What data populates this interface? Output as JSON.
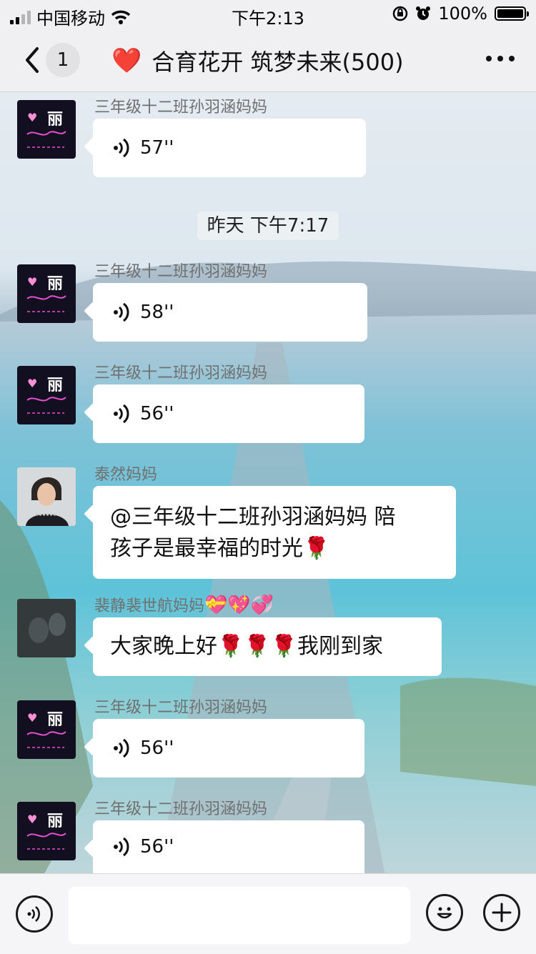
{
  "status_bar": {
    "carrier": "中国移动",
    "time": "下午2:13",
    "battery": "100%",
    "battery_level": 1.0
  },
  "nav": {
    "unread_count": "1",
    "title_emoji": "❤️",
    "title": "合育花开 筑梦未来(500)",
    "more_icon": "more-dots-icon"
  },
  "timestamp": "昨天 下午7:17",
  "messages": [
    {
      "sender": "三年级十二班孙羽涵妈妈",
      "type": "voice",
      "duration": "57''"
    },
    {
      "sender": "三年级十二班孙羽涵妈妈",
      "type": "voice",
      "duration": "58''"
    },
    {
      "sender": "三年级十二班孙羽涵妈妈",
      "type": "voice",
      "duration": "56''"
    },
    {
      "sender": "泰然妈妈",
      "type": "text",
      "lines": [
        "@三年级十二班孙羽涵妈妈 陪",
        "孩子是最幸福的时光🌹"
      ]
    },
    {
      "sender": "裴静裴世航妈妈",
      "sender_emojis": "💝💖💞",
      "type": "text",
      "lines": [
        "大家晚上好🌹🌹🌹我刚到家"
      ]
    },
    {
      "sender": "三年级十二班孙羽涵妈妈",
      "type": "voice",
      "duration": "56''"
    },
    {
      "sender": "三年级十二班孙羽涵妈妈",
      "type": "voice",
      "duration": "56''"
    }
  ],
  "avatar_brand_char": "丽",
  "input_bar": {
    "placeholder": "",
    "left_icon": "voice-icon",
    "emoji_icon": "emoji-icon",
    "plus_icon": "plus-icon"
  },
  "colors": {
    "bubble": "#ffffff",
    "bar_bg": "#f0f0f2",
    "sender_text": "#707070"
  }
}
